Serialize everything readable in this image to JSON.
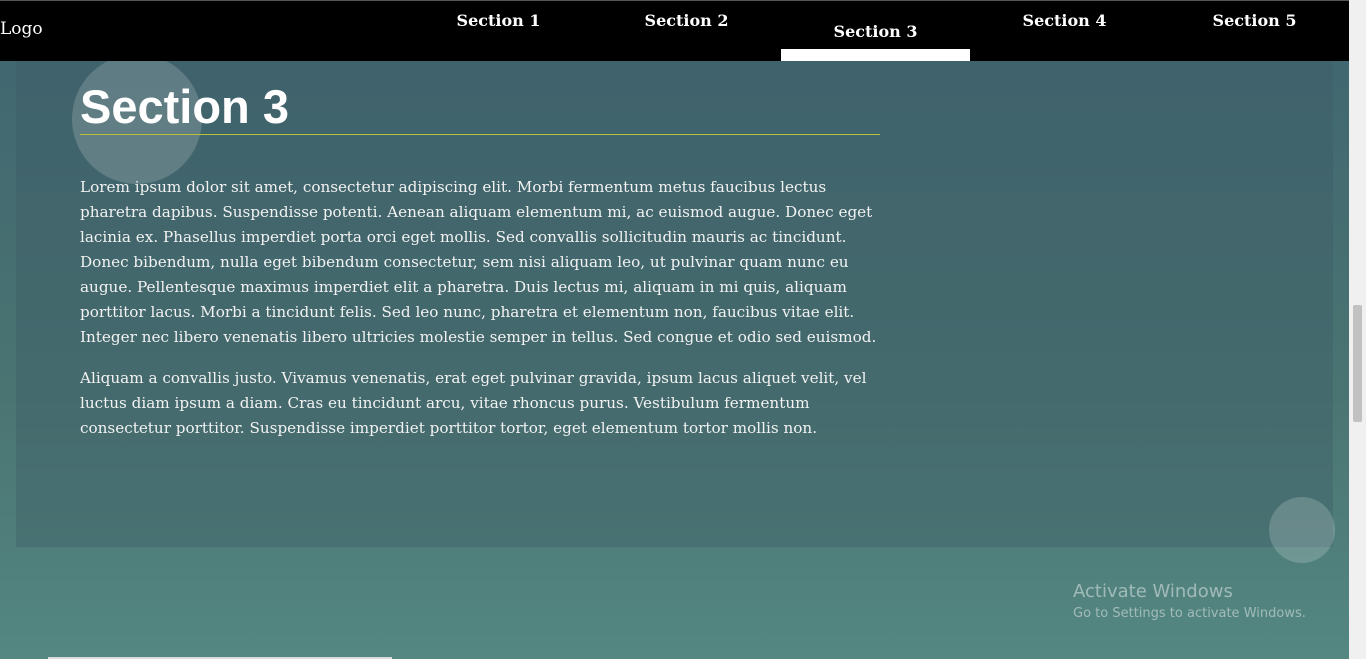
{
  "nav": {
    "logo": "Logo",
    "items": [
      {
        "label": "Section 1",
        "active": false
      },
      {
        "label": "Section 2",
        "active": false
      },
      {
        "label": "Section 3",
        "active": true
      },
      {
        "label": "Section 4",
        "active": false
      },
      {
        "label": "Section 5",
        "active": false
      }
    ]
  },
  "section": {
    "title": "Section 3",
    "paragraphs": [
      "Lorem ipsum dolor sit amet, consectetur adipiscing elit. Morbi fermentum metus faucibus lectus pharetra dapibus. Suspendisse potenti. Aenean aliquam elementum mi, ac euismod augue. Donec eget lacinia ex. Phasellus imperdiet porta orci eget mollis. Sed convallis sollicitudin mauris ac tincidunt. Donec bibendum, nulla eget bibendum consectetur, sem nisi aliquam leo, ut pulvinar quam nunc eu augue. Pellentesque maximus imperdiet elit a pharetra. Duis lectus mi, aliquam in mi quis, aliquam porttitor lacus. Morbi a tincidunt felis. Sed leo nunc, pharetra et elementum non, faucibus vitae elit. Integer nec libero venenatis libero ultricies molestie semper in tellus. Sed congue et odio sed euismod.",
      "Aliquam a convallis justo. Vivamus venenatis, erat eget pulvinar gravida, ipsum lacus aliquet velit, vel luctus diam ipsum a diam. Cras eu tincidunt arcu, vitae rhoncus purus. Vestibulum fermentum consectetur porttitor. Suspendisse imperdiet porttitor tortor, eget elementum tortor mollis non."
    ]
  },
  "watermark": {
    "line1": "Activate Windows",
    "line2": "Go to Settings to activate Windows."
  },
  "colors": {
    "nav_background": "#000000",
    "active_indicator": "#ffffff",
    "title_underline": "#b7c23a",
    "page_background": "#4a7472"
  }
}
